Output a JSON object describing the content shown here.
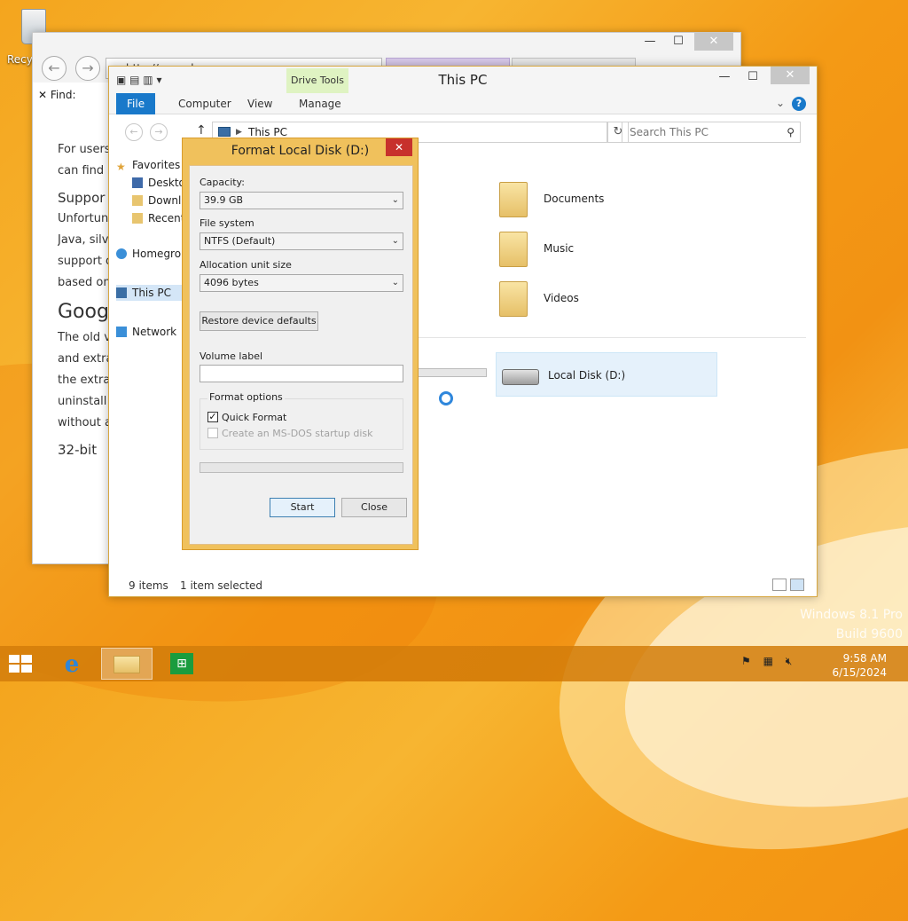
{
  "desktop": {
    "recycle_label": "Recyc",
    "watermark_line1": "Windows 8.1 Pro",
    "watermark_line2": "Build 9600"
  },
  "ie": {
    "find_label": "Find:",
    "address_text": "http://www.d...",
    "content": [
      "For users",
      "can find",
      "Suppor",
      "Unfortun",
      "Java, silv",
      "support o",
      "based on",
      "Goog",
      "The old v",
      "and extra",
      "the extra",
      "uninstall",
      "without a",
      "32-bit"
    ]
  },
  "explorer": {
    "title": "This PC",
    "contextual_tab_group": "Drive Tools",
    "ribbon_tabs": [
      "File",
      "Computer",
      "View",
      "Manage"
    ],
    "address": "This PC",
    "search_placeholder": "Search This PC",
    "nav": {
      "favorites": "Favorites",
      "desktop": "Desktop",
      "downloads": "Downloads",
      "recent": "Recent places",
      "homegroup": "Homegroup",
      "this_pc": "This PC",
      "network": "Network"
    },
    "folders": [
      "Documents",
      "Music",
      "Videos"
    ],
    "drive": "Local Disk (D:)",
    "status_count": "9 items",
    "status_selected": "1 item selected"
  },
  "dialog": {
    "title": "Format Local Disk (D:)",
    "capacity_label": "Capacity:",
    "capacity_value": "39.9 GB",
    "filesystem_label": "File system",
    "filesystem_value": "NTFS (Default)",
    "alloc_label": "Allocation unit size",
    "alloc_value": "4096 bytes",
    "restore_label": "Restore device defaults",
    "volume_label": "Volume label",
    "volume_value": "",
    "options_label": "Format options",
    "quick_format": "Quick Format",
    "msdos": "Create an MS-DOS startup disk",
    "start": "Start",
    "close": "Close"
  },
  "taskbar": {
    "time": "9:58 AM",
    "date": "6/15/2024"
  },
  "colors": {
    "accent": "#1979ca",
    "drive_tools": "#dff3c2",
    "dialog_frame": "#f0c15c"
  }
}
